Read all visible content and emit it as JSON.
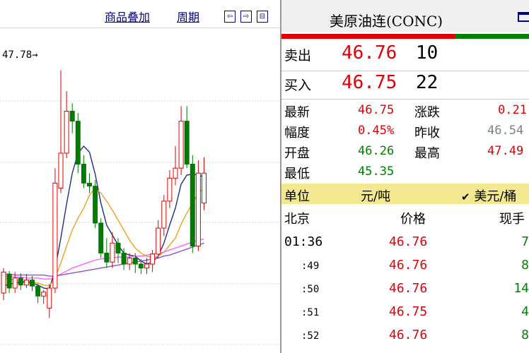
{
  "toolbar": {
    "overlay_label": "商品叠加",
    "period_label": "周期",
    "nav_buttons": [
      "⇦",
      "⇨",
      "⊟"
    ]
  },
  "kline": {
    "price_marker": "47.78→",
    "candles": [
      {
        "o": 45.55,
        "c": 45.76,
        "h": 45.8,
        "l": 45.48,
        "up": true
      },
      {
        "o": 45.74,
        "c": 45.6,
        "h": 45.77,
        "l": 45.55,
        "up": false
      },
      {
        "o": 45.6,
        "c": 45.7,
        "h": 45.76,
        "l": 45.55,
        "up": true
      },
      {
        "o": 45.7,
        "c": 45.63,
        "h": 45.75,
        "l": 45.58,
        "up": false
      },
      {
        "o": 45.63,
        "c": 45.68,
        "h": 45.74,
        "l": 45.6,
        "up": true
      },
      {
        "o": 45.68,
        "c": 45.62,
        "h": 45.72,
        "l": 45.57,
        "up": false
      },
      {
        "o": 45.62,
        "c": 45.52,
        "h": 45.64,
        "l": 45.45,
        "up": false
      },
      {
        "o": 45.52,
        "c": 45.56,
        "h": 45.58,
        "l": 45.44,
        "up": true
      },
      {
        "o": 45.4,
        "c": 45.6,
        "h": 45.64,
        "l": 45.3,
        "up": true
      },
      {
        "o": 45.6,
        "c": 46.65,
        "h": 46.8,
        "l": 45.55,
        "up": true
      },
      {
        "o": 46.6,
        "c": 46.95,
        "h": 47.78,
        "l": 46.55,
        "up": true
      },
      {
        "o": 46.95,
        "c": 47.37,
        "h": 47.57,
        "l": 46.9,
        "up": true
      },
      {
        "o": 47.37,
        "c": 47.27,
        "h": 47.45,
        "l": 47.15,
        "up": false
      },
      {
        "o": 47.27,
        "c": 46.84,
        "h": 47.35,
        "l": 46.75,
        "up": false
      },
      {
        "o": 46.84,
        "c": 46.65,
        "h": 46.93,
        "l": 46.6,
        "up": false
      },
      {
        "o": 46.65,
        "c": 46.62,
        "h": 46.75,
        "l": 46.55,
        "up": false
      },
      {
        "o": 46.62,
        "c": 46.25,
        "h": 46.68,
        "l": 46.2,
        "up": false
      },
      {
        "o": 46.25,
        "c": 45.95,
        "h": 46.3,
        "l": 45.9,
        "up": false
      },
      {
        "o": 45.95,
        "c": 45.86,
        "h": 46.1,
        "l": 45.8,
        "up": false
      },
      {
        "o": 45.86,
        "c": 46.05,
        "h": 46.16,
        "l": 45.8,
        "up": true
      },
      {
        "o": 46.05,
        "c": 45.95,
        "h": 46.1,
        "l": 45.85,
        "up": false
      },
      {
        "o": 45.95,
        "c": 45.84,
        "h": 46.0,
        "l": 45.78,
        "up": false
      },
      {
        "o": 45.84,
        "c": 45.9,
        "h": 45.95,
        "l": 45.78,
        "up": true
      },
      {
        "o": 45.9,
        "c": 45.84,
        "h": 45.95,
        "l": 45.75,
        "up": false
      },
      {
        "o": 45.84,
        "c": 45.8,
        "h": 45.89,
        "l": 45.74,
        "up": false
      },
      {
        "o": 45.8,
        "c": 45.84,
        "h": 45.9,
        "l": 45.74,
        "up": true
      },
      {
        "o": 45.84,
        "c": 45.94,
        "h": 45.98,
        "l": 45.76,
        "up": true
      },
      {
        "o": 45.94,
        "c": 46.2,
        "h": 46.28,
        "l": 45.9,
        "up": true
      },
      {
        "o": 46.2,
        "c": 46.47,
        "h": 46.53,
        "l": 46.12,
        "up": true
      },
      {
        "o": 46.47,
        "c": 46.7,
        "h": 46.78,
        "l": 46.4,
        "up": true
      },
      {
        "o": 46.7,
        "c": 46.8,
        "h": 47.02,
        "l": 46.63,
        "up": true
      },
      {
        "o": 46.8,
        "c": 47.27,
        "h": 47.42,
        "l": 46.73,
        "up": true
      },
      {
        "o": 47.27,
        "c": 46.84,
        "h": 47.42,
        "l": 46.8,
        "up": false
      },
      {
        "o": 46.84,
        "c": 46.02,
        "h": 46.93,
        "l": 45.95,
        "up": false
      },
      {
        "o": 46.02,
        "c": 46.75,
        "h": 46.88,
        "l": 45.97,
        "up": true
      },
      {
        "o": 46.45,
        "c": 46.75,
        "h": 46.91,
        "l": 46.38,
        "up": true
      }
    ],
    "ma_lines": [
      {
        "name": "MA5",
        "color": "#1c2d8f",
        "values": [
          45.62,
          45.64,
          45.65,
          45.66,
          45.66,
          45.65,
          45.63,
          45.6,
          45.59,
          45.79,
          46.1,
          46.44,
          46.75,
          46.95,
          47.02,
          46.96,
          46.74,
          46.45,
          46.23,
          46.13,
          46.03,
          45.95,
          45.93,
          45.92,
          45.87,
          45.84,
          45.86,
          45.92,
          46.05,
          46.23,
          46.4,
          46.64,
          46.73,
          46.74,
          46.73,
          46.71
        ]
      },
      {
        "name": "MA10",
        "color": "#f0a020",
        "values": [
          45.7,
          45.69,
          45.68,
          45.67,
          45.67,
          45.66,
          45.65,
          45.63,
          45.62,
          45.7,
          45.85,
          46.02,
          46.18,
          46.3,
          46.4,
          46.53,
          46.6,
          46.55,
          46.47,
          46.38,
          46.28,
          46.18,
          46.08,
          46.0,
          45.95,
          45.92,
          45.9,
          45.92,
          45.96,
          46.03,
          46.1,
          46.24,
          46.35,
          46.45,
          46.55,
          46.6
        ]
      },
      {
        "name": "MA20",
        "color": "#ff60ff",
        "values": [
          45.72,
          45.72,
          45.71,
          45.71,
          45.7,
          45.7,
          45.7,
          45.69,
          45.69,
          45.71,
          45.74,
          45.77,
          45.8,
          45.82,
          45.84,
          45.86,
          45.88,
          45.89,
          45.9,
          45.9,
          45.91,
          45.91,
          45.91,
          45.92,
          45.92,
          45.93,
          45.94,
          45.95,
          45.96,
          45.98,
          46.0,
          46.02,
          46.04,
          46.06,
          46.08,
          46.09
        ]
      },
      {
        "name": "MA60",
        "color": "#9050d0",
        "values": [
          45.74,
          45.74,
          45.73,
          45.73,
          45.73,
          45.73,
          45.73,
          45.73,
          45.72,
          45.72,
          45.73,
          45.74,
          45.75,
          45.76,
          45.77,
          45.78,
          45.79,
          45.8,
          45.81,
          45.82,
          45.83,
          45.84,
          45.85,
          45.86,
          45.87,
          45.88,
          45.89,
          45.9,
          45.92,
          45.93,
          45.95,
          45.97,
          45.99,
          46.01,
          46.03,
          46.05
        ]
      }
    ],
    "colors": {
      "up": "#e00000",
      "down": "#007a00",
      "grid": "#cfd8cf"
    }
  },
  "quote": {
    "title": "美原油连(CONC)",
    "header_icon": "window-icon",
    "sell_label": "卖出",
    "sell_price": "46.76",
    "sell_volume": "10",
    "buy_label": "买入",
    "buy_price": "46.75",
    "buy_volume": "22",
    "latest_label": "最新",
    "latest_value": "46.75",
    "change_label": "涨跌",
    "change_value": "0.21",
    "amplitude_label": "幅度",
    "amplitude_value": "0.45%",
    "prev_close_label": "昨收",
    "prev_close_value": "46.54",
    "open_label": "开盘",
    "open_value": "46.26",
    "high_label": "最高",
    "high_value": "47.49",
    "low_label": "最低",
    "low_value": "45.35",
    "unit_label": "单位",
    "unit_value": "元/吨",
    "currency_check": "✔",
    "currency_value": "美元/桶",
    "colors": {
      "bid_ask_bar_red": "#e00000",
      "bid_ask_bar_green": "#008000",
      "unit_row_bg": "#f4e890",
      "header_bg": "#f0f0f0"
    }
  },
  "ticks": {
    "col_place": "北京",
    "col_price": "价格",
    "col_volume": "现手",
    "rows": [
      {
        "time": "01:36",
        "price": "46.76",
        "volume": "7"
      },
      {
        "time": ":49",
        "price": "46.76",
        "volume": "8"
      },
      {
        "time": ":50",
        "price": "46.76",
        "volume": "14"
      },
      {
        "time": ":51",
        "price": "46.75",
        "volume": "4"
      },
      {
        "time": ":52",
        "price": "46.76",
        "volume": "8"
      }
    ]
  }
}
